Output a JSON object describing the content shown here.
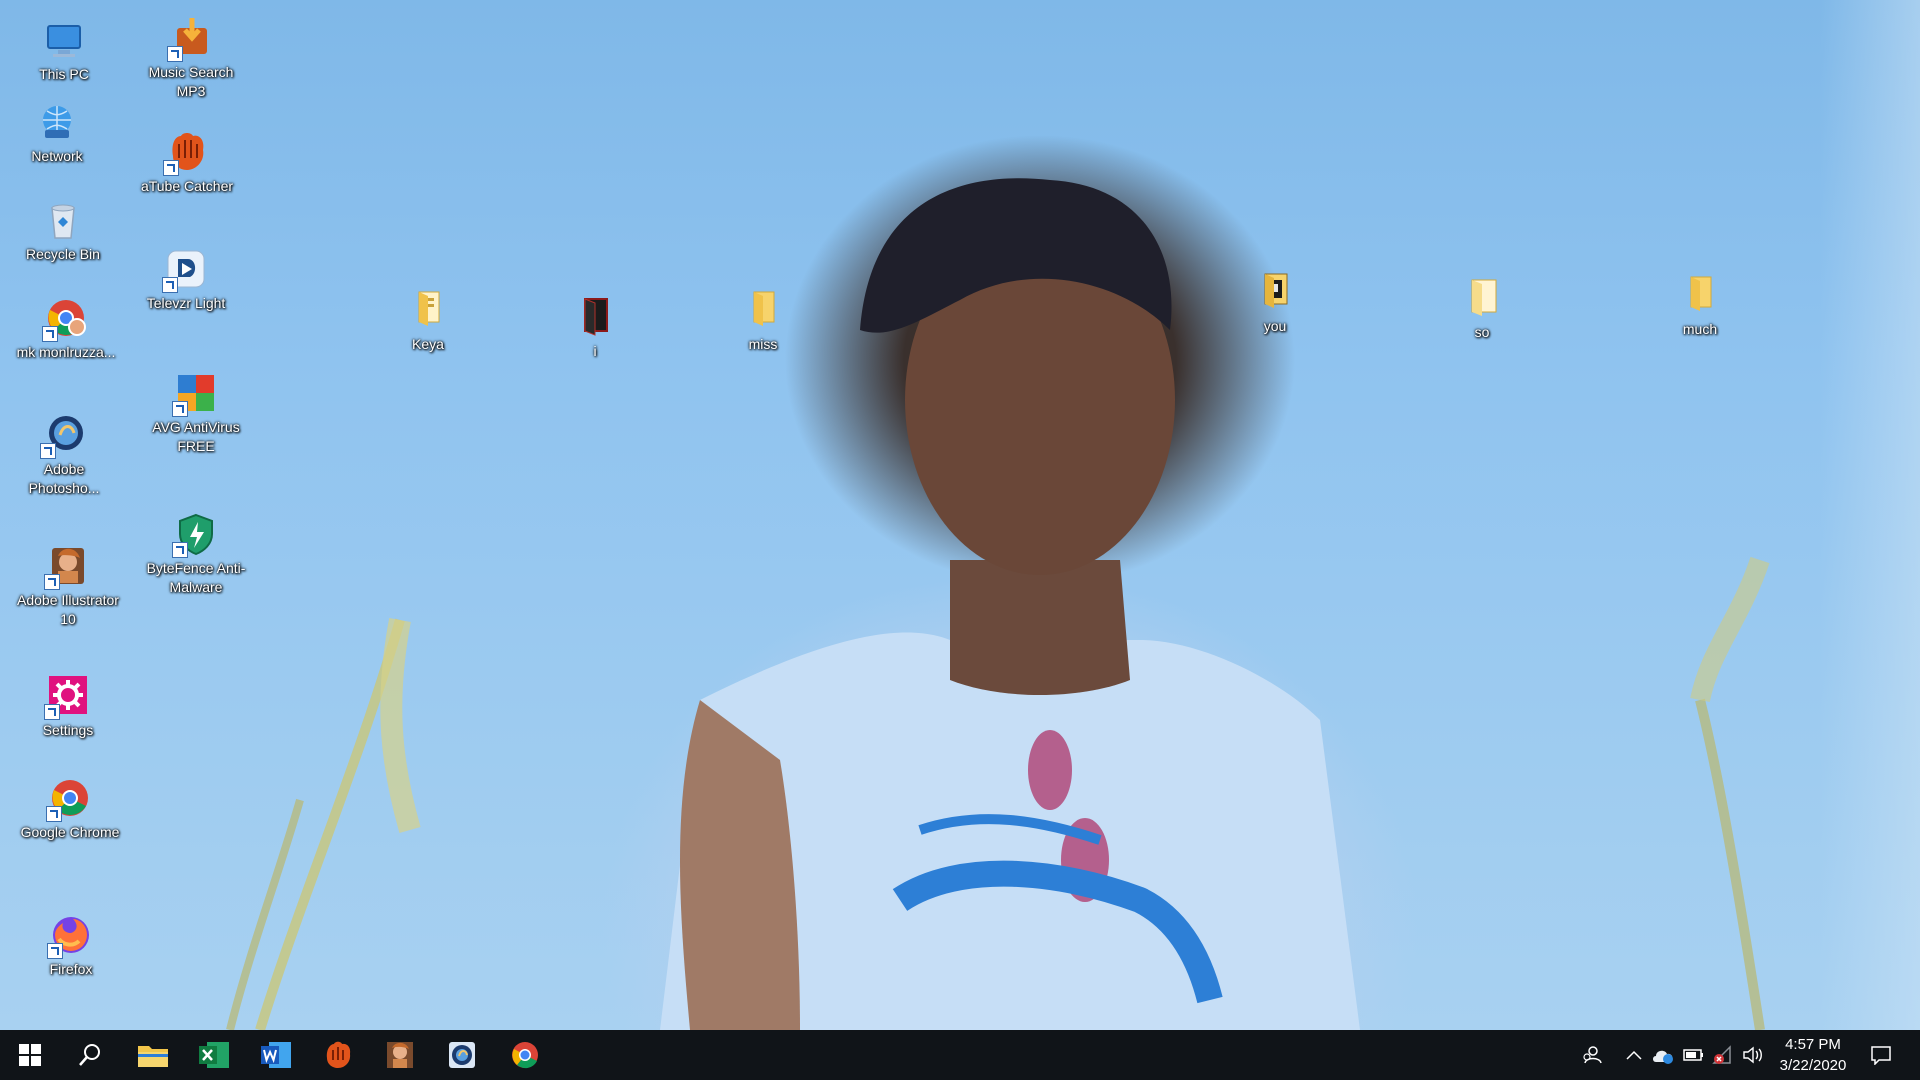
{
  "desktop": {
    "icons_left": [
      {
        "label": "This PC",
        "icon": "this-pc-icon"
      },
      {
        "label": "Network",
        "icon": "network-icon"
      },
      {
        "label": "Recycle Bin",
        "icon": "recycle-bin-icon"
      },
      {
        "label": "mk monlruzza...",
        "icon": "chrome-profile-icon"
      },
      {
        "label": "Adobe Photosho...",
        "icon": "photoshop-icon"
      },
      {
        "label": "Adobe Illustrator 10",
        "icon": "illustrator-icon"
      },
      {
        "label": "Settings",
        "icon": "settings-icon"
      },
      {
        "label": "Google Chrome",
        "icon": "chrome-icon"
      },
      {
        "label": "Firefox",
        "icon": "firefox-icon"
      }
    ],
    "icons_second": [
      {
        "label": "Music Search MP3",
        "icon": "music-search-icon"
      },
      {
        "label": "aTube Catcher",
        "icon": "atube-catcher-icon"
      },
      {
        "label": "Televzr Light",
        "icon": "televzr-icon"
      },
      {
        "label": "AVG AntiVirus FREE",
        "icon": "avg-icon"
      },
      {
        "label": "ByteFence Anti-Malware",
        "icon": "bytefence-icon"
      }
    ],
    "folders": [
      {
        "label": "Keya"
      },
      {
        "label": "i"
      },
      {
        "label": "miss"
      },
      {
        "label": "you"
      },
      {
        "label": "so"
      },
      {
        "label": "much"
      }
    ]
  },
  "taskbar": {
    "pinned": [
      {
        "name": "start",
        "icon": "windows-icon"
      },
      {
        "name": "search",
        "icon": "search-icon"
      },
      {
        "name": "file-explorer",
        "icon": "folder-icon"
      },
      {
        "name": "excel",
        "icon": "excel-icon"
      },
      {
        "name": "word",
        "icon": "word-icon"
      },
      {
        "name": "atube-catcher",
        "icon": "atube-icon"
      },
      {
        "name": "illustrator",
        "icon": "illustrator-icon"
      },
      {
        "name": "photoshop",
        "icon": "photoshop-icon"
      },
      {
        "name": "chrome",
        "icon": "chrome-icon"
      }
    ],
    "tray": {
      "time": "4:57 PM",
      "date": "3/22/2020"
    }
  },
  "colors": {
    "taskbar_bg": "#101418",
    "folder_yellow": "#f3c64a",
    "sky": "#8fc3ef"
  }
}
